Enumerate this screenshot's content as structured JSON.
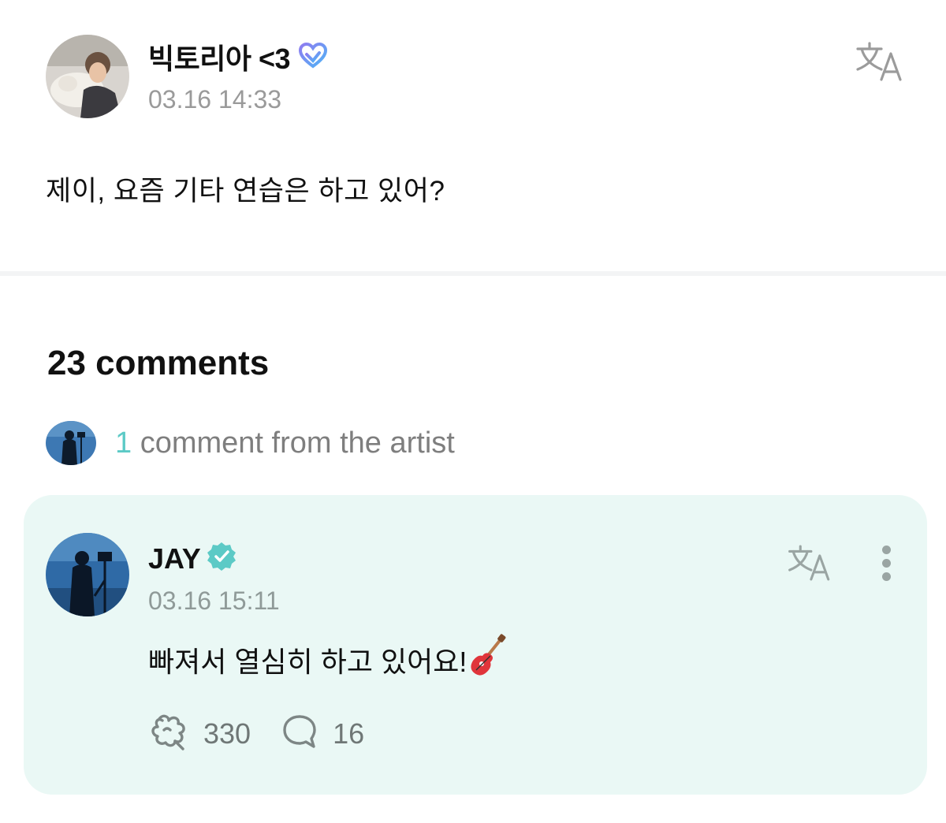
{
  "post": {
    "author": {
      "name": "빅토리아 <3",
      "badge_icon": "membership-heart-icon"
    },
    "timestamp": "03.16 14:33",
    "body": "제이, 요즘 기타 연습은 하고 있어?",
    "translate_icon": "translate-icon"
  },
  "comments": {
    "count_label": "23 comments",
    "artist_filter": {
      "count": "1",
      "label": "comment from the artist"
    }
  },
  "artist_comment": {
    "author": {
      "name": "JAY",
      "badge_icon": "verified-badge-icon"
    },
    "timestamp": "03.16 15:11",
    "text": "빠져서 열심히 하고 있어요!",
    "emoji": "🎸",
    "likes": "330",
    "replies": "16",
    "translate_icon": "translate-icon",
    "more_icon": "more-vertical-icon"
  },
  "colors": {
    "accent": "#5ccac6",
    "comment_bg": "#eaf8f5",
    "muted_text": "#9a9a9a",
    "membership_badge_start": "#8f7cf0",
    "membership_badge_end": "#4fb3f6"
  }
}
